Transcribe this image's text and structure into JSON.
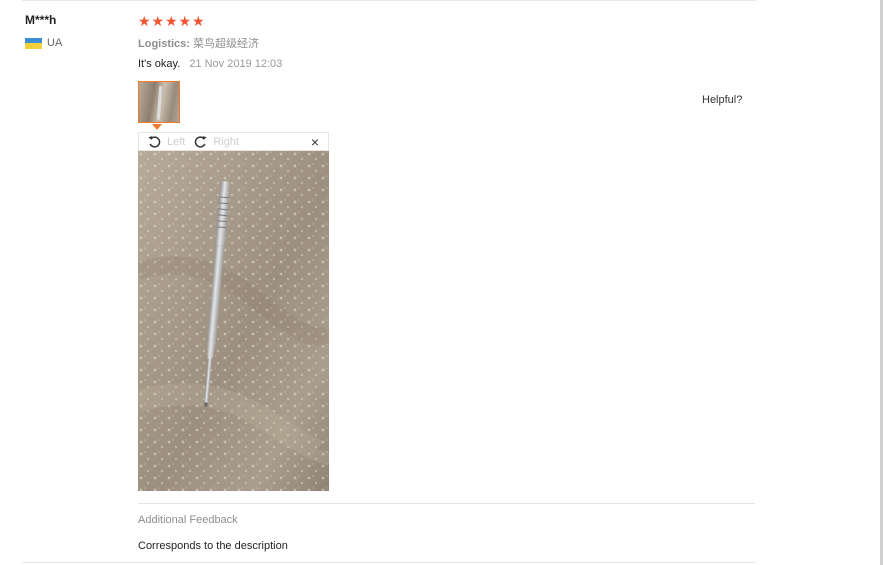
{
  "review": {
    "user_name": "M***h",
    "country": "UA",
    "rating": 5,
    "stars": [
      "★",
      "★",
      "★",
      "★",
      "★"
    ],
    "logistics_label": "Logistics:",
    "logistics_value": "菜鸟超级经济",
    "text": "It's okay.",
    "date": "21 Nov 2019 12:03",
    "helpful_label": "Helpful?",
    "viewer": {
      "rotate_left_label": "Left",
      "rotate_right_label": "Right",
      "close_label": "×"
    },
    "additional_feedback_title": "Additional Feedback",
    "additional_feedback_text": "Corresponds to the description"
  },
  "colors": {
    "star": "#f2542f",
    "thumb_border": "#f27a2f",
    "flag_blue": "#3a8fd6",
    "flag_yellow": "#f2d23a"
  }
}
